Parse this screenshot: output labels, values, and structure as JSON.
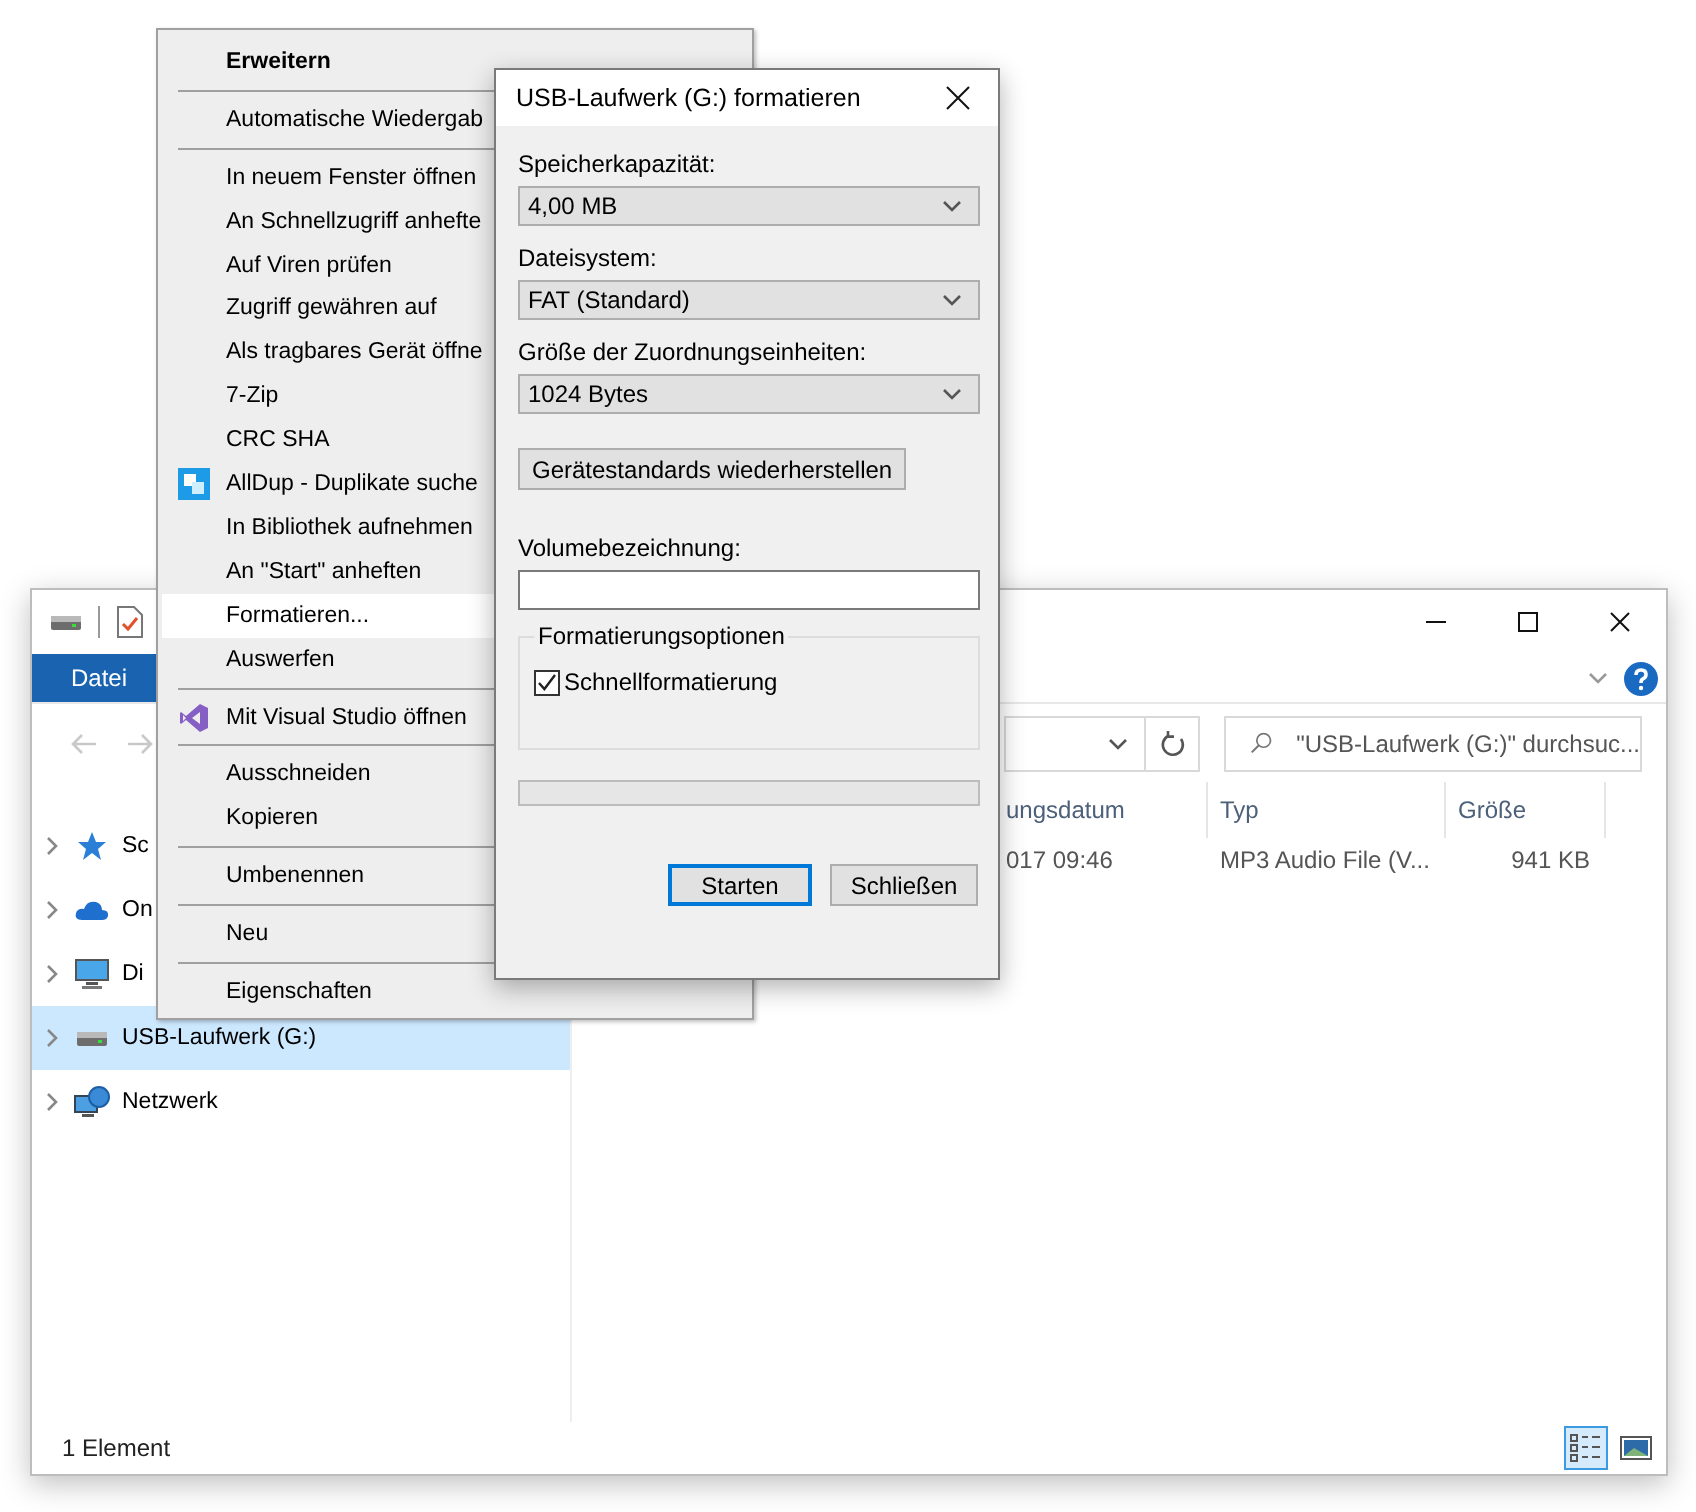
{
  "explorer": {
    "ribbon_tabs": [
      {
        "label": "Datei",
        "selected": true
      }
    ],
    "search": {
      "placeholder": "\"USB-Laufwerk (G:)\" durchsuc..."
    },
    "sidebar": {
      "items": [
        {
          "label": "Sc",
          "kind": "favorites",
          "selected": false
        },
        {
          "label": "On",
          "kind": "cloud",
          "selected": false
        },
        {
          "label": "Di",
          "kind": "computer",
          "selected": false
        },
        {
          "label": "USB-Laufwerk (G:)",
          "kind": "drive",
          "selected": true
        },
        {
          "label": "Netzwerk",
          "kind": "network",
          "selected": false
        }
      ]
    },
    "table": {
      "columns": [
        "ungsdatum",
        "Typ",
        "Größe"
      ],
      "rows": [
        [
          "017 09:46",
          "MP3 Audio File (V...",
          "941 KB"
        ]
      ]
    },
    "status_bar": {
      "text": "1 Element",
      "views": [
        {
          "kind": "details",
          "selected": true
        },
        {
          "kind": "tiles",
          "selected": false
        }
      ]
    }
  },
  "context_menu": {
    "items": [
      {
        "kind": "item",
        "label": "Erweitern",
        "bold": true,
        "selected": false
      },
      {
        "kind": "separator"
      },
      {
        "kind": "item",
        "label": "Automatische Wiedergab",
        "bold": false,
        "selected": false
      },
      {
        "kind": "separator"
      },
      {
        "kind": "item",
        "label": "In neuem Fenster öffnen",
        "bold": false,
        "selected": false
      },
      {
        "kind": "item",
        "label": "An Schnellzugriff anhefte",
        "bold": false,
        "selected": false
      },
      {
        "kind": "item",
        "label": "Auf Viren prüfen",
        "bold": false,
        "selected": false
      },
      {
        "kind": "item",
        "label": "Zugriff gewähren auf",
        "bold": false,
        "selected": false
      },
      {
        "kind": "item",
        "label": "Als tragbares Gerät öffne",
        "bold": false,
        "selected": false
      },
      {
        "kind": "item",
        "label": "7-Zip",
        "bold": false,
        "selected": false
      },
      {
        "kind": "item",
        "label": "CRC SHA",
        "bold": false,
        "selected": false
      },
      {
        "kind": "item",
        "label": "AllDup - Duplikate suche",
        "bold": false,
        "selected": false
      },
      {
        "kind": "item",
        "label": "In Bibliothek aufnehmen",
        "bold": false,
        "selected": false
      },
      {
        "kind": "item",
        "label": "An \"Start\" anheften",
        "bold": false,
        "selected": false
      },
      {
        "kind": "item",
        "label": "Formatieren...",
        "bold": false,
        "selected": true
      },
      {
        "kind": "item",
        "label": "Auswerfen",
        "bold": false,
        "selected": false
      },
      {
        "kind": "separator"
      },
      {
        "kind": "item",
        "label": "Mit Visual Studio öffnen",
        "bold": false,
        "selected": false
      },
      {
        "kind": "separator"
      },
      {
        "kind": "item",
        "label": "Ausschneiden",
        "bold": false,
        "selected": false
      },
      {
        "kind": "item",
        "label": "Kopieren",
        "bold": false,
        "selected": false
      },
      {
        "kind": "separator"
      },
      {
        "kind": "item",
        "label": "Umbenennen",
        "bold": false,
        "selected": false
      },
      {
        "kind": "separator"
      },
      {
        "kind": "item",
        "label": "Neu",
        "bold": false,
        "selected": false
      },
      {
        "kind": "separator"
      },
      {
        "kind": "item",
        "label": "Eigenschaften",
        "bold": false,
        "selected": false
      }
    ]
  },
  "dialog": {
    "title": "USB-Laufwerk (G:) formatieren",
    "fields": [
      {
        "label": "Speicherkapazität:",
        "value": "4,00 MB"
      },
      {
        "label": "Dateisystem:",
        "value": "FAT (Standard)"
      },
      {
        "label": "Größe der Zuordnungseinheiten:",
        "value": "1024 Bytes"
      }
    ],
    "restore_button": "Gerätestandards wiederherstellen",
    "volume_label": {
      "label": "Volumebezeichnung:"
    },
    "options": {
      "title": "Formatierungsoptionen",
      "items": [
        {
          "label": "Schnellformatierung",
          "checked": true
        }
      ]
    },
    "progress": {
      "level": 0
    },
    "buttons": [
      {
        "label": "Starten",
        "default": true
      },
      {
        "label": "Schließen",
        "default": false
      }
    ]
  }
}
